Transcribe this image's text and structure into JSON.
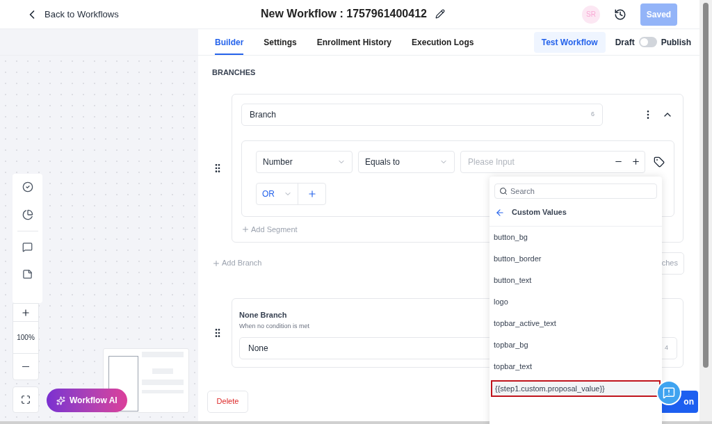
{
  "header": {
    "back_link": "Back to Workflows",
    "title": "New Workflow : 1757961400412",
    "avatar": "SR",
    "saved_button": "Saved"
  },
  "tabs": [
    {
      "label": "Builder",
      "selected": true
    },
    {
      "label": "Settings",
      "selected": false
    },
    {
      "label": "Enrollment History",
      "selected": false
    },
    {
      "label": "Execution Logs",
      "selected": false
    }
  ],
  "test_button": "Test Workflow",
  "publish_toggle": {
    "off_label": "Draft",
    "on_label": "Publish",
    "on": false
  },
  "canvas": {
    "zoom": "100%",
    "ai_button": "Workflow AI"
  },
  "section_title": "BRANCHES",
  "branch": {
    "name": "Branch",
    "count": "6",
    "condition": {
      "field": "Number",
      "operator": "Equals to",
      "placeholder": "Please Input"
    },
    "logic": "OR",
    "add_segment": "Add Segment"
  },
  "add_branch": "Add Branch",
  "partial_button": "ches",
  "none_branch": {
    "title": "None Branch",
    "subtitle": "When no condition is met",
    "value": "None",
    "count": "4"
  },
  "delete_button": "Delete",
  "save_button": "on",
  "dropdown": {
    "search_placeholder": "Search",
    "header": "Custom Values",
    "items": [
      {
        "label": "button_bg",
        "selected": false
      },
      {
        "label": "button_border",
        "selected": false
      },
      {
        "label": "button_text",
        "selected": false
      },
      {
        "label": "logo",
        "selected": false
      },
      {
        "label": "topbar_active_text",
        "selected": false
      },
      {
        "label": "topbar_bg",
        "selected": false
      },
      {
        "label": "topbar_text",
        "selected": false
      },
      {
        "label": "{{step1.custom.proposal_value}}",
        "selected": true
      }
    ]
  }
}
